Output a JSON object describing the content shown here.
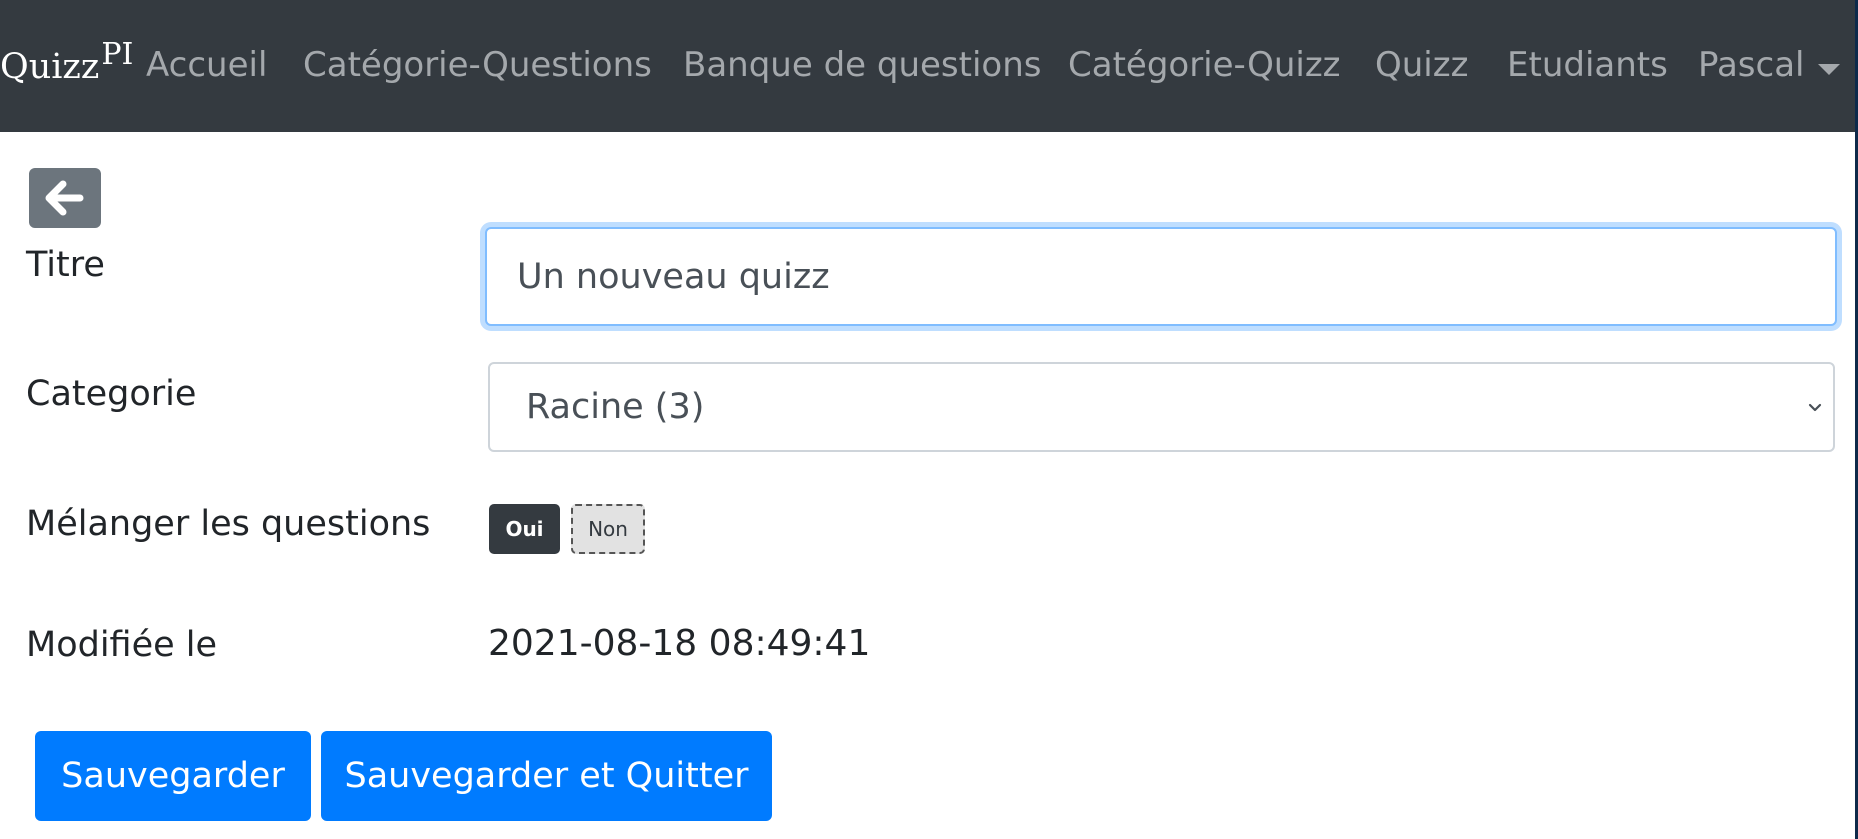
{
  "navbar": {
    "brand": "Quizz",
    "brand_sup": "PI",
    "links": [
      "Accueil",
      "Catégorie-Questions",
      "Banque de questions",
      "Catégorie-Quizz",
      "Quizz",
      "Etudiants"
    ],
    "user_menu": "Pascal",
    "background_color": "#343a40"
  },
  "back_button": {
    "icon": "arrow-left-icon"
  },
  "form": {
    "title": {
      "label": "Titre",
      "value": "Un nouveau quizz"
    },
    "category": {
      "label": "Categorie",
      "selected": "Racine (3)"
    },
    "shuffle": {
      "label": "Mélanger les questions",
      "yes": "Oui",
      "no": "Non",
      "selected": "Oui"
    },
    "modified": {
      "label": "Modifiée le",
      "value": "2021-08-18 08:49:41"
    }
  },
  "actions": {
    "save": "Sauvegarder",
    "save_and_quit": "Sauvegarder et Quitter",
    "primary_color": "#007bff"
  }
}
